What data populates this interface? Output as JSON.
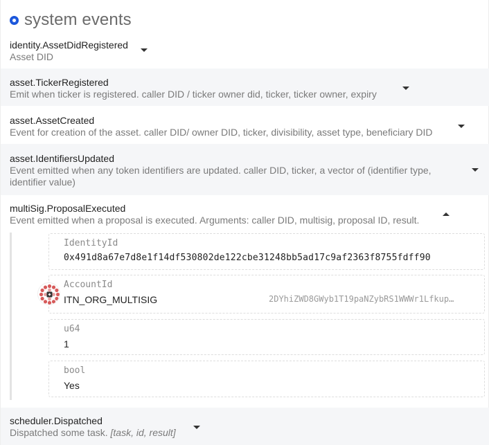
{
  "header": {
    "title": "system events"
  },
  "events": [
    {
      "name": "identity.AssetDidRegistered",
      "desc": "Asset DID"
    },
    {
      "name": "asset.TickerRegistered",
      "desc": "Emit when ticker is registered. caller DID / ticker owner did, ticker, ticker owner, expiry"
    },
    {
      "name": "asset.AssetCreated",
      "desc": "Event for creation of the asset. caller DID/ owner DID, ticker, divisibility, asset type, beneficiary DID"
    },
    {
      "name": "asset.IdentifiersUpdated",
      "desc_line1": "Event emitted when any token identifiers are updated. caller DID, ticker, a vector of (identifier type,",
      "desc_line2": "identifier value)"
    },
    {
      "name": "multiSig.ProposalExecuted",
      "desc": "Event emitted when a proposal is executed. Arguments: caller DID, multisig, proposal ID, result."
    },
    {
      "name": "scheduler.Dispatched",
      "desc": "Dispatched some task.",
      "args": "[task, id, result]"
    }
  ],
  "params": [
    {
      "label": "IdentityId",
      "value": "0x491d8a67e7d8e1f14df530802de122cbe31248bb5ad17c9af2363f8755fdff90"
    },
    {
      "label": "AccountId",
      "value": "ITN_ORG_MULTISIG",
      "address": "2DYhiZWD8GWyb1T19paNZybRS1WWWr1Lfkup…"
    },
    {
      "label": "u64",
      "value": "1"
    },
    {
      "label": "bool",
      "value": "Yes"
    }
  ],
  "icons": {
    "status": "radio-dot-icon",
    "expand": "chevron-down-icon",
    "collapse": "chevron-up-icon",
    "account": "identicon-avatar"
  },
  "colors": {
    "accent": "#1a56db",
    "shaded_row": "#f5f6f8"
  }
}
